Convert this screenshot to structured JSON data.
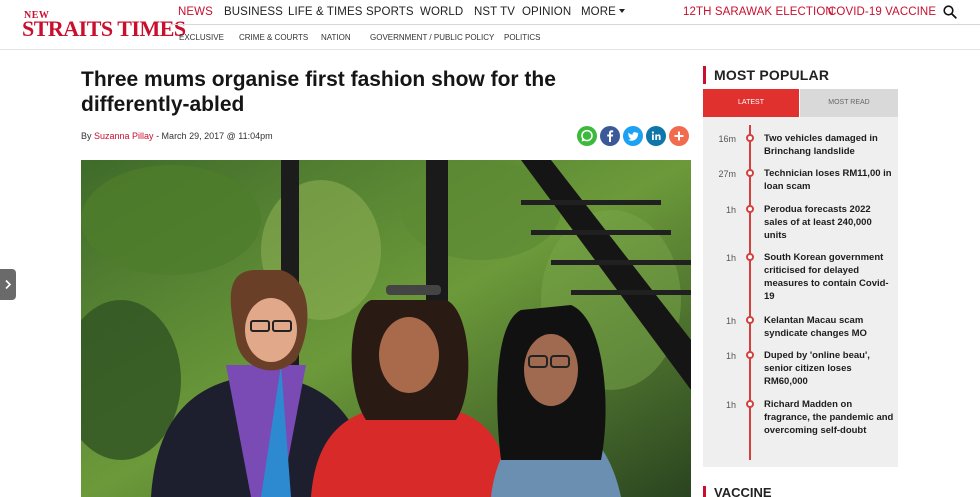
{
  "logo": {
    "small": "NEW",
    "big": "STRAITS TIMES"
  },
  "nav": {
    "primary": [
      "NEWS",
      "BUSINESS",
      "LIFE & TIMES",
      "SPORTS",
      "WORLD",
      "NST TV",
      "OPINION",
      "MORE"
    ],
    "highlights": [
      "12TH SARAWAK ELECTION",
      "COVID-19 VACCINE"
    ],
    "active": "NEWS",
    "secondary": [
      "EXCLUSIVE",
      "CRIME & COURTS",
      "NATION",
      "GOVERNMENT / PUBLIC POLICY",
      "POLITICS"
    ]
  },
  "article": {
    "headline": "Three mums organise first fashion show for the differently-abled",
    "byline_prefix": "By ",
    "author": "Suzanna Pillay",
    "date": " - March 29, 2017 @ 11:04pm",
    "share": [
      {
        "name": "whatsapp",
        "color": "#3cba3c"
      },
      {
        "name": "facebook",
        "color": "#3b5998"
      },
      {
        "name": "twitter",
        "color": "#1da1f2"
      },
      {
        "name": "linkedin",
        "color": "#0e76a8"
      },
      {
        "name": "more",
        "color": "#f26b4f"
      }
    ]
  },
  "sidebar": {
    "title": "MOST POPULAR",
    "tabs": [
      "LATEST",
      "MOST READ"
    ],
    "items": [
      {
        "time": "16m",
        "text": "Two vehicles damaged in Brinchang landslide"
      },
      {
        "time": "27m",
        "text": "Technician loses RM11,00 in loan scam"
      },
      {
        "time": "1h",
        "text": "Perodua forecasts 2022 sales of at least 240,000 units"
      },
      {
        "time": "1h",
        "text": "South Korean government criticised for delayed measures to contain Covid-19"
      },
      {
        "time": "1h",
        "text": "Kelantan Macau scam syndicate changes MO"
      },
      {
        "time": "1h",
        "text": "Duped by 'online beau', senior citizen loses RM60,000"
      },
      {
        "time": "1h",
        "text": "Richard Madden on fragrance, the pandemic and overcoming self-doubt"
      }
    ],
    "next_section": "VACCINE"
  },
  "colors": {
    "brand": "#c8102e",
    "tab_active": "#e0312f"
  }
}
